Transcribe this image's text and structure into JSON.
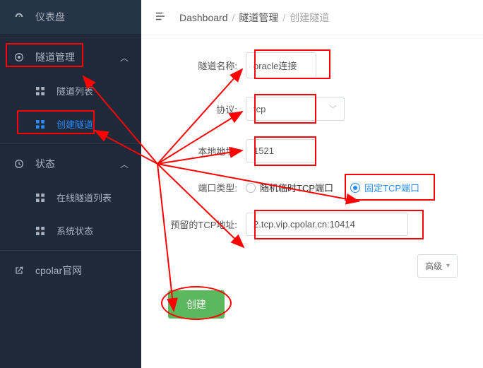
{
  "sidebar": {
    "dashboard": "仪表盘",
    "tunnel_mgmt": "隧道管理",
    "tunnel_list": "隧道列表",
    "create_tunnel": "创建隧道",
    "status": "状态",
    "online_tunnels": "在线隧道列表",
    "system_status": "系统状态",
    "cpolar_site": "cpolar官网"
  },
  "breadcrumb": {
    "root": "Dashboard",
    "mid": "隧道管理",
    "leaf": "创建隧道"
  },
  "form": {
    "name_label": "隧道名称:",
    "name_value": "oracle连接",
    "proto_label": "协议:",
    "proto_value": "tcp",
    "local_label": "本地地址:",
    "local_value": "1521",
    "port_type_label": "端口类型:",
    "port_random": "随机临时TCP端口",
    "port_fixed": "固定TCP端口",
    "reserved_label": "预留的TCP地址:",
    "reserved_value": "2.tcp.vip.cpolar.cn:10414",
    "advanced": "高级",
    "create": "创建"
  }
}
